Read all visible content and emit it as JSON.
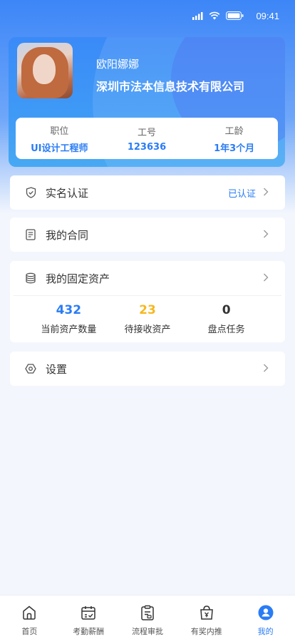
{
  "status_bar": {
    "time": "09:41"
  },
  "profile": {
    "name": "欧阳娜娜",
    "company": "深圳市法本信息技术有限公司",
    "info": [
      {
        "label": "职位",
        "value": "UI设计工程师"
      },
      {
        "label": "工号",
        "value": "123636"
      },
      {
        "label": "工龄",
        "value": "1年3个月"
      }
    ]
  },
  "menu": {
    "realname": {
      "title": "实名认证",
      "status": "已认证",
      "icon": "shield-check-icon"
    },
    "contract": {
      "title": "我的合同",
      "icon": "document-icon"
    },
    "assets": {
      "title": "我的固定资产",
      "icon": "database-icon",
      "stats": [
        {
          "value": "432",
          "label": "当前资产数量",
          "color": "#2a7cf5"
        },
        {
          "value": "23",
          "label": "待接收资产",
          "color": "#f5b820"
        },
        {
          "value": "0",
          "label": "盘点任务",
          "color": "#333333"
        }
      ]
    },
    "settings": {
      "title": "设置",
      "icon": "gear-icon"
    }
  },
  "tabbar": {
    "tabs": [
      {
        "label": "首页",
        "icon": "home-icon"
      },
      {
        "label": "考勤薪酬",
        "icon": "calendar-icon"
      },
      {
        "label": "流程审批",
        "icon": "clipboard-icon"
      },
      {
        "label": "有奖内推",
        "icon": "gift-bag-icon"
      },
      {
        "label": "我的",
        "icon": "user-icon",
        "active": true
      }
    ]
  },
  "colors": {
    "accent": "#2a7cf5",
    "warning": "#f5b820"
  }
}
